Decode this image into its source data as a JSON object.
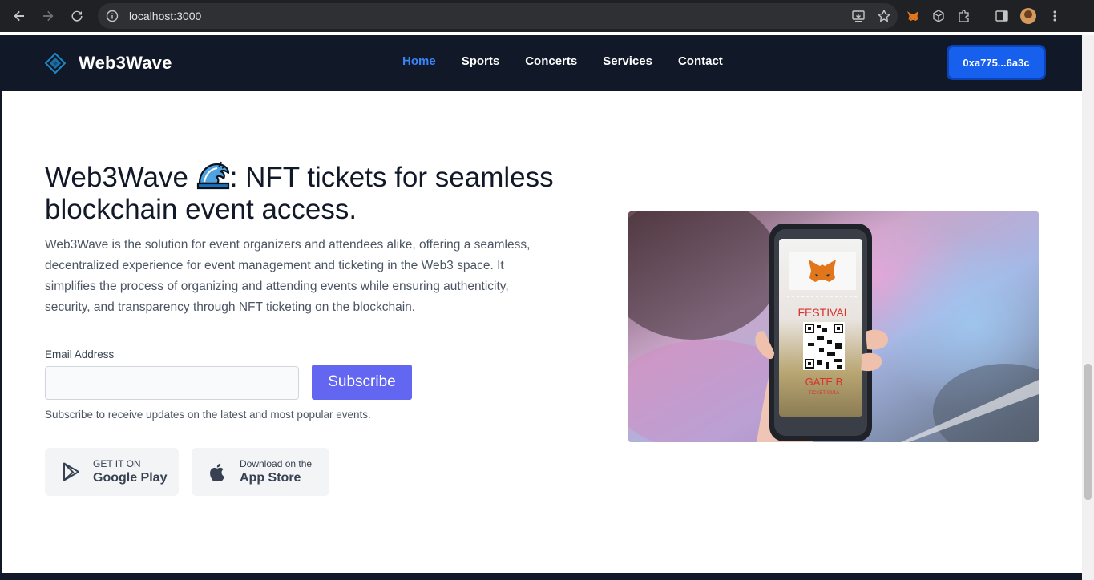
{
  "browser": {
    "url": "localhost:3000",
    "icons": [
      "back-icon",
      "forward-icon",
      "reload-icon",
      "site-info-icon",
      "install-icon",
      "bookmark-star-icon",
      "metamask-extension-icon",
      "cube-extension-icon",
      "puzzle-extensions-icon",
      "side-panel-icon",
      "profile-avatar",
      "kebab-menu-icon"
    ]
  },
  "nav": {
    "brand": "Web3Wave",
    "links": [
      {
        "label": "Home",
        "active": true
      },
      {
        "label": "Sports",
        "active": false
      },
      {
        "label": "Concerts",
        "active": false
      },
      {
        "label": "Services",
        "active": false
      },
      {
        "label": "Contact",
        "active": false
      }
    ],
    "wallet": "0xa775...6a3c"
  },
  "hero": {
    "title_prefix": "Web3Wave ",
    "title_emoji": "🌊",
    "title_suffix": ": NFT tickets for seamless blockchain event access.",
    "description": "Web3Wave is the solution for event organizers and attendees alike, offering a seamless, decentralized experience for event management and ticketing in the Web3 space. It simplifies the process of organizing and attending events while ensuring authenticity, security, and transparency through NFT ticketing on the blockchain."
  },
  "subscribe": {
    "label": "Email Address",
    "value": "",
    "button": "Subscribe",
    "note": "Subscribe to receive updates on the latest and most popular events."
  },
  "stores": {
    "google": {
      "small": "GET IT ON",
      "big": "Google Play"
    },
    "apple": {
      "small": "Download on the",
      "big": "App Store"
    }
  },
  "image": {
    "ticket_title": "FESTIVAL",
    "ticket_gate": "GATE B",
    "ticket_sub": "TICKET 00/1A"
  },
  "colors": {
    "nav_bg": "#111827",
    "active_link": "#3b82f6",
    "wallet_button": "#1760ee",
    "subscribe_button": "#6366f1"
  }
}
